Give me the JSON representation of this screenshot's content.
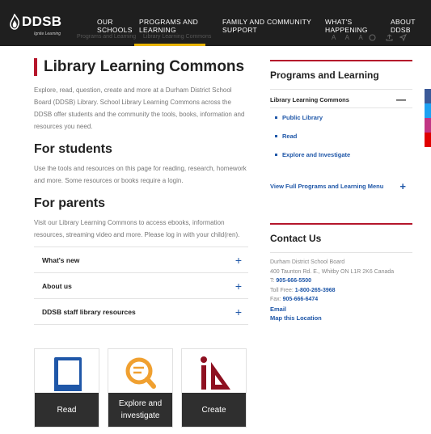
{
  "topnav": {
    "logo_text": "DDSB",
    "logo_tagline": "Ignite Learning",
    "items": [
      {
        "label": "OUR SCHOOLS"
      },
      {
        "label": "PROGRAMS AND LEARNING"
      },
      {
        "label": "FAMILY AND COMMUNITY SUPPORT"
      },
      {
        "label": "WHAT'S HAPPENING"
      },
      {
        "label": "ABOUT DDSB"
      }
    ],
    "breadcrumb_faded": "Programs and Learning",
    "breadcrumb_faded_2": "Library Learning Commons",
    "tools_text": "A A A"
  },
  "main": {
    "title": "Library Learning Commons",
    "intro": "Explore, read, question, create and more at a Durham District School Board (DDSB) Library. School Library Learning Commons across the DDSB offer students and the community the tools, books, information and resources you need.",
    "students_heading": "For students",
    "students_text": "Use the tools and resources on this page for reading, research, homework and more.  Some resources or books require a login.",
    "parents_heading": "For parents",
    "parents_text": "Visit our Library Learning Commons to access ebooks, information resources, streaming video and more.  Please log in with your child(ren).",
    "accordion": [
      {
        "label": "What's new"
      },
      {
        "label": "About us"
      },
      {
        "label": "DDSB staff library resources"
      }
    ],
    "tiles": [
      {
        "label": "Read"
      },
      {
        "label": "Explore and investigate"
      },
      {
        "label": "Create"
      }
    ]
  },
  "sidebar": {
    "title": "Programs and Learning",
    "active": "Library Learning Commons",
    "sub_items": [
      {
        "label": "Public Library"
      },
      {
        "label": "Read"
      },
      {
        "label": "Explore and Investigate"
      }
    ],
    "full_menu": "View Full Programs and Learning Menu"
  },
  "contact": {
    "title": "Contact Us",
    "name": "Durham District School Board",
    "address": "400 Taunton Rd. E., Whitby ON L1R 2K6 Canada",
    "phone_label": "T:",
    "phone": "905-666-5500",
    "tollfree_label": "Toll Free:",
    "tollfree": "1-800-265-3968",
    "fax_label": "Fax:",
    "fax": "905-666-6474",
    "email": "Email",
    "map": "Map this Location"
  },
  "colors": {
    "accent_red": "#b5162b",
    "link_blue": "#1f57a8",
    "nav_bg": "#1f1f1f",
    "nav_active": "#e8b400"
  }
}
